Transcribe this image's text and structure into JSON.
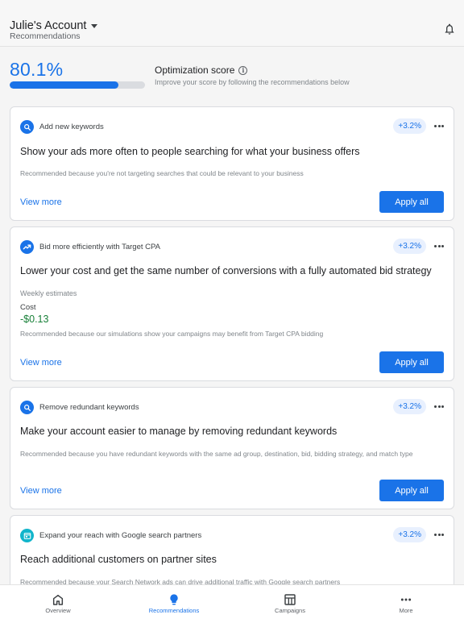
{
  "header": {
    "account_name": "Julie's Account",
    "subtitle": "Recommendations"
  },
  "score": {
    "percent": "80.1%",
    "progress_value": 0.801,
    "title": "Optimization score",
    "subtitle": "Improve your score by following the recommendations below"
  },
  "cards": [
    {
      "icon": "search-icon",
      "category": "Add new keywords",
      "badge": "+3.2%",
      "title": "Show your ads more often to people searching for what your business offers",
      "reason": "Recommended because you're not targeting searches that could be relevant to your business",
      "view_more": "View more",
      "apply": "Apply all"
    },
    {
      "icon": "trending-up-icon",
      "category": "Bid more efficiently with Target CPA",
      "badge": "+3.2%",
      "title": "Lower your cost and get the same number of conversions with a fully automated bid strategy",
      "estimates_label": "Weekly estimates",
      "cost_label": "Cost",
      "cost_value": "-$0.13",
      "reason": "Recommended because our simulations show your campaigns may benefit from Target CPA bidding",
      "view_more": "View more",
      "apply": "Apply all"
    },
    {
      "icon": "search-icon",
      "category": "Remove redundant keywords",
      "badge": "+3.2%",
      "title": "Make your account easier to manage by removing redundant keywords",
      "reason": "Recommended because you have redundant keywords with the same ad group, destination, bid, bidding strategy, and match type",
      "view_more": "View more",
      "apply": "Apply all"
    },
    {
      "icon": "search-partners-icon",
      "category": "Expand your reach with Google search partners",
      "badge": "+3.2%",
      "title": "Reach additional customers on partner sites",
      "reason": "Recommended because your Search Network ads can drive additional traffic with Google search partners"
    }
  ],
  "nav": [
    {
      "label": "Overview",
      "icon": "home-icon",
      "active": false
    },
    {
      "label": "Recommendations",
      "icon": "lightbulb-icon",
      "active": true
    },
    {
      "label": "Campaigns",
      "icon": "campaigns-icon",
      "active": false
    },
    {
      "label": "More",
      "icon": "more-icon",
      "active": false
    }
  ],
  "colors": {
    "accent": "#1a73e8",
    "positive": "#188038",
    "badge_bg": "#e8f0fe",
    "partner_icon": "#12b5cb"
  }
}
